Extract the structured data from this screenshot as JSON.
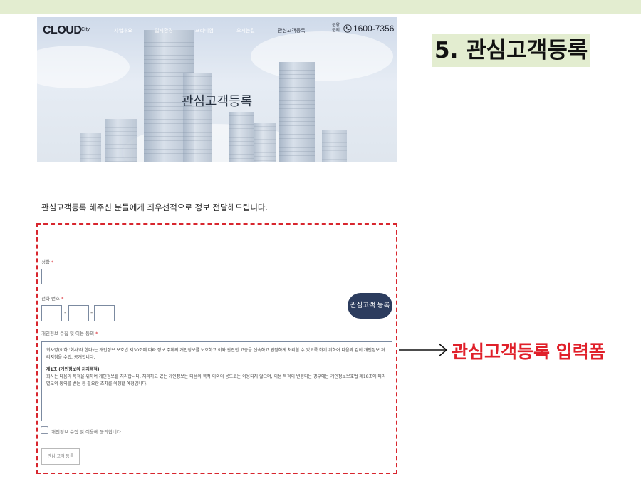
{
  "header": {
    "logo": "CLOUD",
    "logo_sub": "City",
    "nav_items": [
      "사업개요",
      "입지환경",
      "프리미엄",
      "오시는길",
      "관심고객등록"
    ],
    "phone_label": "분양문의",
    "phone_number": "1600-7356",
    "hero_title": "관심고객등록"
  },
  "section_title": "5. 관심고객등록",
  "annotation": "관심고객등록 입력폼",
  "intro_text": "관심고객등록 해주신 분들에게 최우선적으로 정보 전달해드립니다.",
  "form": {
    "name_label": "성함",
    "phone_label": "전화 번호",
    "required_mark": "*",
    "phone_separator": "-",
    "register_button": "관심고객 등록",
    "consent_label": "개인정보 수집 및 이용 동의",
    "terms_intro": "회사명(이하 '회사'라 한다)는 개인정보 보호법 제30조에 따라 정보 주체의 개인정보를 보호하고 이와 관련한 고충을 신속하고 원활하게 처리할 수 있도록 하기 위하여 다음과 같이 개인정보 처리지침을 수립, 공개합니다.",
    "terms_heading": "제1조 (개인정보의 처리목적)",
    "terms_body": "회사는 다음의 목적을 위하여 개인정보를 처리합니다. 처리하고 있는 개인정보는 다음의 목적 이외의 용도로는 이용되지 않으며, 이용 목적이 변경되는 경우에는 개인정보보호법 제18조에 따라 별도의 동의를 받는 등 필요한 조치를 이행할 예정입니다.",
    "agree_text": "개인정보 수집 및 이용에 동의합니다.",
    "submit_button": "관심 고객 등록"
  },
  "colors": {
    "accent_green": "#e3edd0",
    "annotation_red": "#e0202a",
    "button_navy": "#2c3c5e"
  }
}
